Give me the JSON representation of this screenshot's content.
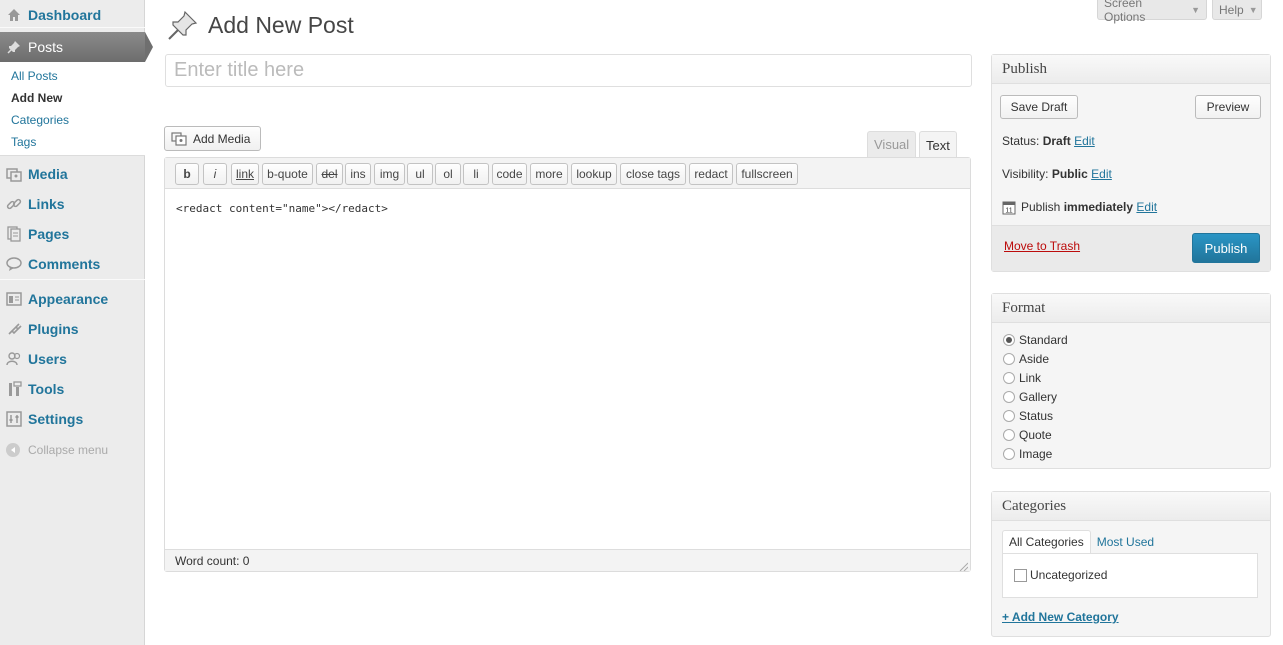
{
  "sidebar": {
    "dashboard": "Dashboard",
    "posts": "Posts",
    "submenu": {
      "all_posts": "All Posts",
      "add_new": "Add New",
      "categories": "Categories",
      "tags": "Tags"
    },
    "media": "Media",
    "links": "Links",
    "pages": "Pages",
    "comments": "Comments",
    "appearance": "Appearance",
    "plugins": "Plugins",
    "users": "Users",
    "tools": "Tools",
    "settings": "Settings",
    "collapse": "Collapse menu"
  },
  "screen_meta": {
    "screen_options": "Screen Options",
    "help": "Help"
  },
  "page": {
    "title": "Add New Post",
    "title_placeholder": "Enter title here",
    "title_value": ""
  },
  "editor": {
    "add_media": "Add Media",
    "tab_visual": "Visual",
    "tab_text": "Text",
    "quicktags": {
      "b": "b",
      "i": "i",
      "link": "link",
      "bquote": "b-quote",
      "del": "del",
      "ins": "ins",
      "img": "img",
      "ul": "ul",
      "ol": "ol",
      "li": "li",
      "code": "code",
      "more": "more",
      "lookup": "lookup",
      "close_tags": "close tags",
      "redact": "redact",
      "fullscreen": "fullscreen"
    },
    "content": "<redact content=\"name\"></redact>",
    "word_count": "Word count: 0"
  },
  "publish": {
    "heading": "Publish",
    "save_draft": "Save Draft",
    "preview": "Preview",
    "status_label": "Status:",
    "status_value": "Draft",
    "visibility_label": "Visibility:",
    "visibility_value": "Public",
    "publish_label": "Publish",
    "publish_value": "immediately",
    "edit": "Edit",
    "move_to_trash": "Move to Trash",
    "publish_button": "Publish"
  },
  "format": {
    "heading": "Format",
    "options": [
      "Standard",
      "Aside",
      "Link",
      "Gallery",
      "Status",
      "Quote",
      "Image"
    ],
    "selected": "Standard"
  },
  "categories": {
    "heading": "Categories",
    "tab_all": "All Categories",
    "tab_most_used": "Most Used",
    "items": [
      "Uncategorized"
    ],
    "add_new": "+ Add New Category"
  },
  "colors": {
    "link": "#21759b",
    "trash": "#bc0b0b",
    "publish_button": "#21759b",
    "sidebar_bg": "#ececec",
    "active_menu": "#6d6d6d"
  }
}
